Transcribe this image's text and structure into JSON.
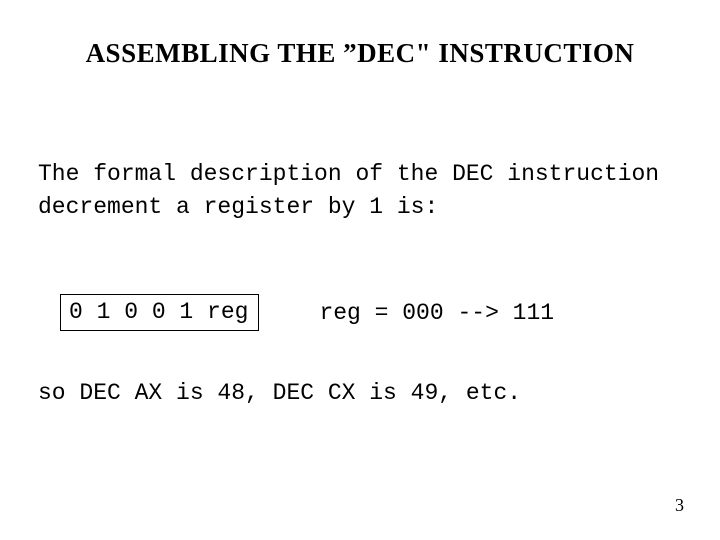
{
  "title": "ASSEMBLING THE ”DEC\" INSTRUCTION",
  "description": "The formal description of the DEC instruction decrement a register by 1 is:",
  "opcode": "0 1 0 0 1 reg",
  "reg_range": "reg = 000 --> 111",
  "examples": "so DEC AX is 48, DEC CX is 49, etc.",
  "page_number": "3"
}
